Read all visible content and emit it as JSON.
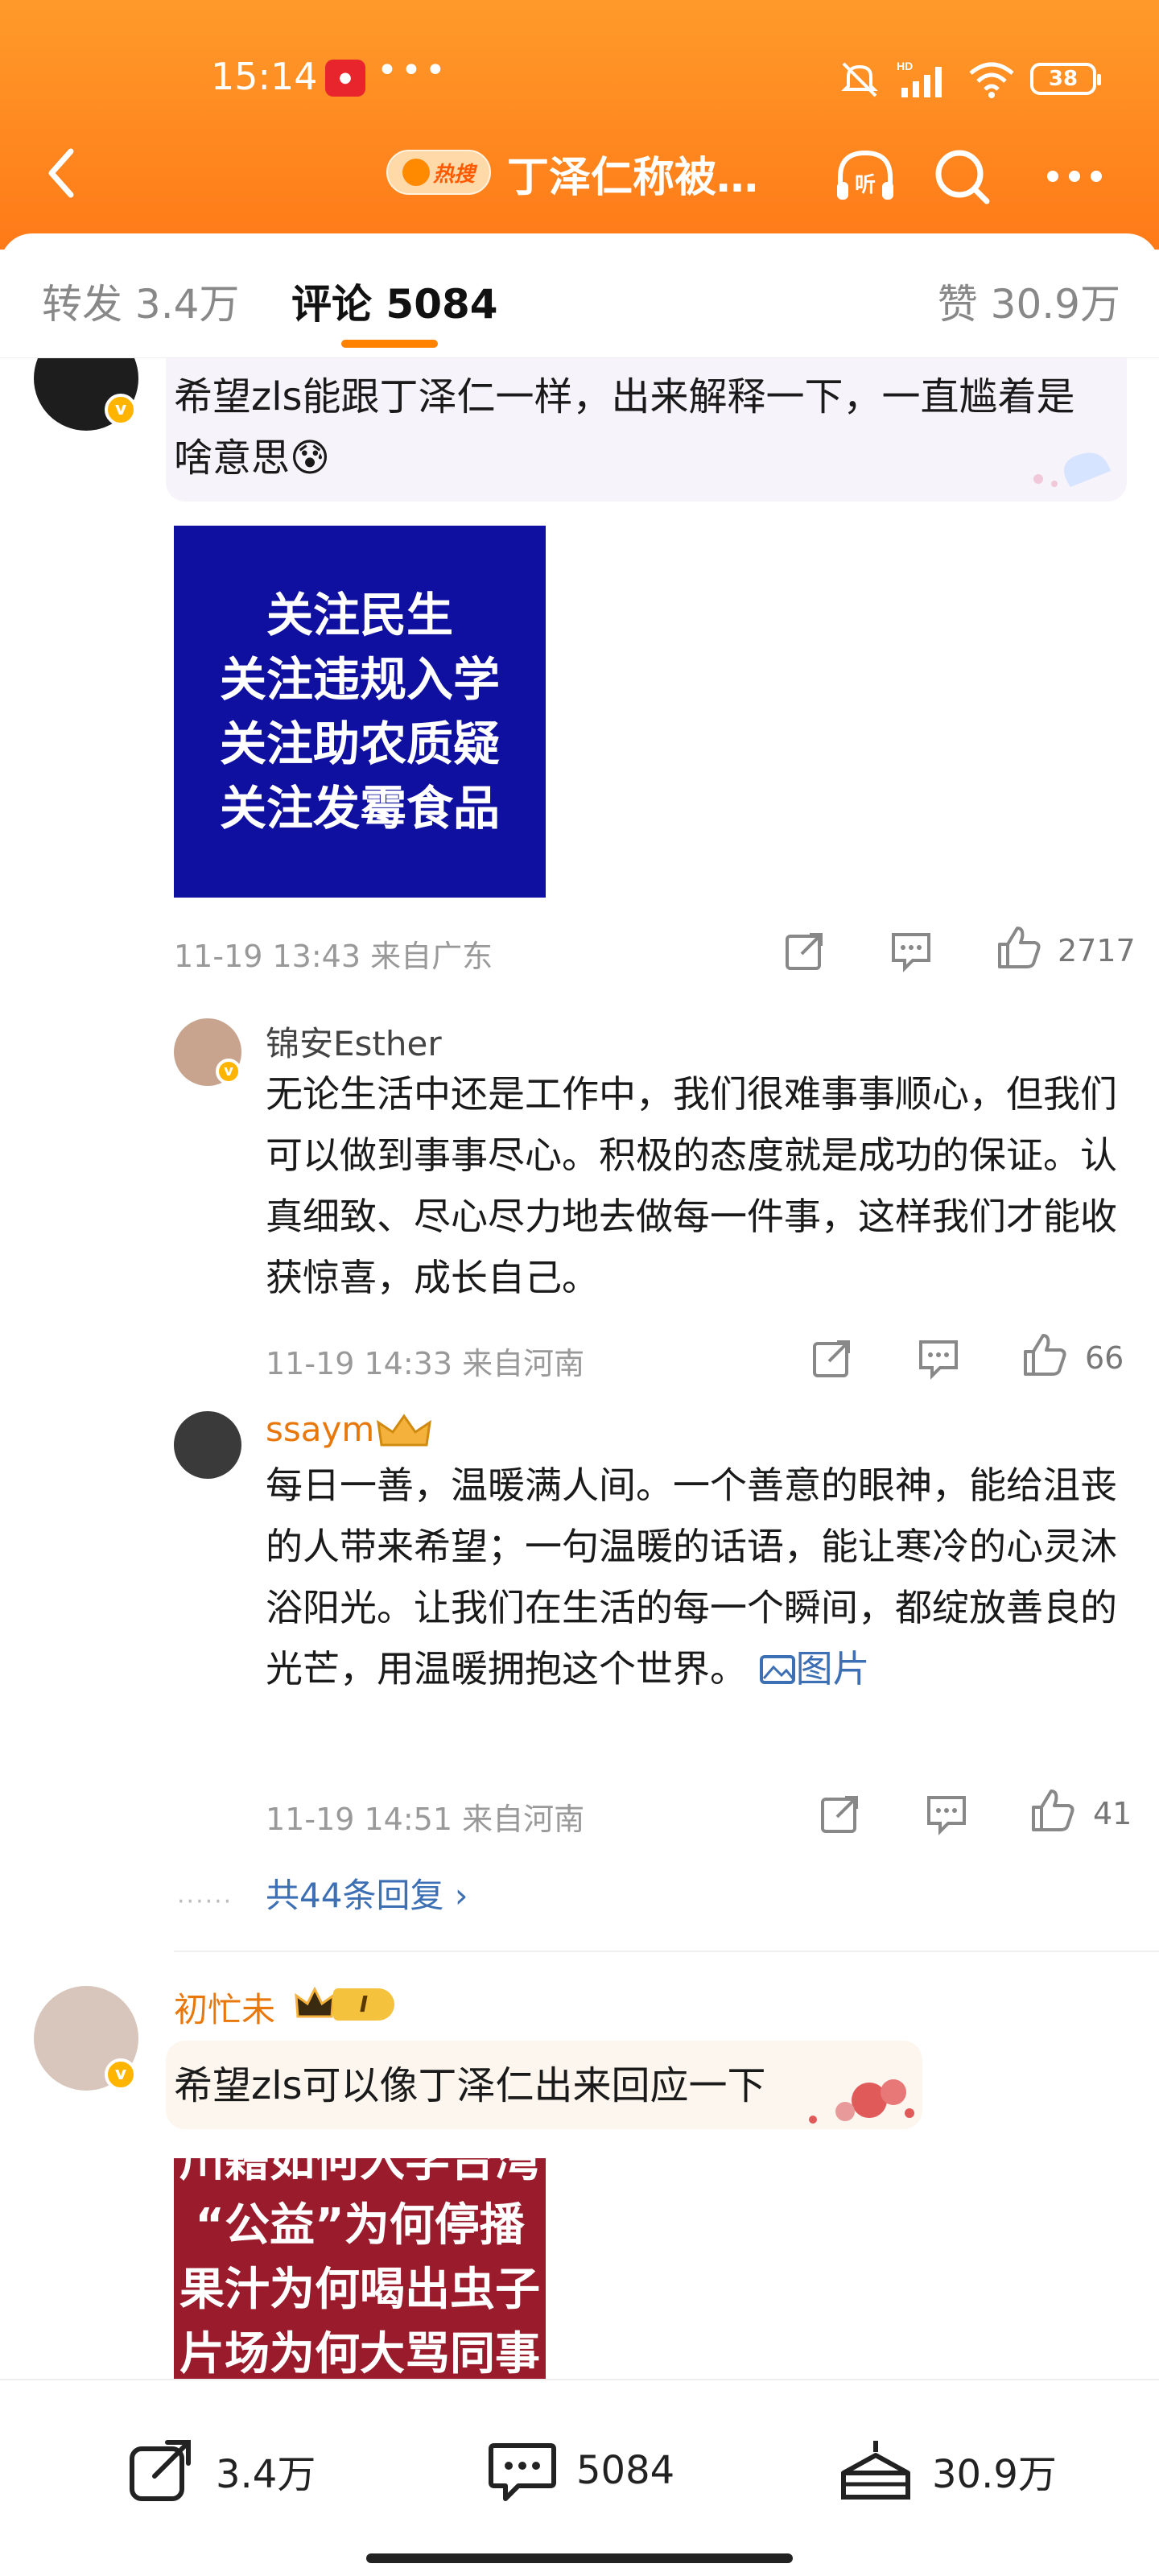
{
  "status": {
    "time": "15:14",
    "battery": "38"
  },
  "header": {
    "hot_badge": "热搜",
    "title": "丁泽仁称被…"
  },
  "tabs": {
    "forward": "转发 3.4万",
    "comments": "评论 5084",
    "likes": "赞 30.9万"
  },
  "comment1": {
    "text": "希望zls能跟丁泽仁一样，出来解释一下，一直尴着是啥意思😰",
    "poster_lines": [
      "关注民生",
      "关注违规入学",
      "关注助农质疑",
      "关注发霉食品"
    ],
    "meta": "11-19 13:43  来自广东",
    "likes": "2717"
  },
  "reply1": {
    "name": "锦安Esther",
    "text": "无论生活中还是工作中，我们很难事事顺心，但我们可以做到事事尽心。积极的态度就是成功的保证。认真细致、尽心尽力地去做每一件事，这样我们才能收获惊喜，成长自己。",
    "meta": "11-19 14:33  来自河南",
    "likes": "66"
  },
  "reply2": {
    "name": "ssaym",
    "text": "每日一善，温暖满人间。一个善意的眼神，能给沮丧的人带来希望；一句温暖的话语，能让寒冷的心灵沐浴阳光。让我们在生活的每一个瞬间，都绽放善良的光芒，用温暖拥抱这个世界。",
    "image_link": "图片",
    "meta": "11-19 14:51  来自河南",
    "likes": "41"
  },
  "more_replies": "共44条回复 ›",
  "comment2": {
    "name": "初忙未",
    "level": "I",
    "text": "希望zls可以像丁泽仁出来回应一下",
    "poster_lines": [
      "川籍如何入学台湾",
      "“公益”为何停播",
      "果汁为何喝出虫子",
      "片场为何大骂同事"
    ]
  },
  "bottom_bar": {
    "forward": "3.4万",
    "comments": "5084",
    "likes": "30.9万"
  },
  "colors": {
    "accent": "#ff8200",
    "link": "#3c6fb4",
    "name_orange": "#e8780c"
  }
}
